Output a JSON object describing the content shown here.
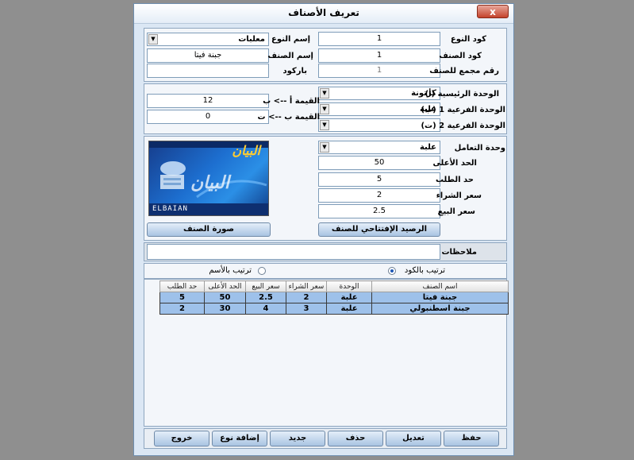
{
  "window": {
    "title": "تعريف الأصناف",
    "close_glyph": "x"
  },
  "basic": {
    "type_code_label": "كود النوع",
    "type_code_value": "1",
    "type_name_label": "إسم النوع",
    "type_name_value": "معلبات",
    "item_code_label": "كود الصنف",
    "item_code_value": "1",
    "item_name_label": "إسم الصنف",
    "item_name_value": "جبنة فيتا",
    "group_no_label": "رقم مجمع للصنف",
    "group_no_value": "1",
    "barcode_label": "باركود",
    "barcode_value": ""
  },
  "units": {
    "main_unit_label": "الوحدة الرئيسية (أ)",
    "main_unit_value": "كرتونة",
    "sub1_label": "الوحدة الفرعية 1 (ب)",
    "sub1_value": "علبة",
    "sub2_label": "الوحدة الفرعية 2 (ت)",
    "sub2_value": "",
    "value_ab_label": "القيمة أ --> ب",
    "value_ab": "12",
    "value_bt_label": "القيمة ب --> ت",
    "value_bt": "0"
  },
  "pricing": {
    "deal_unit_label": "وحدة التعامل",
    "deal_unit_value": "علبة",
    "max_label": "الحد الأعلى",
    "max_value": "50",
    "reorder_label": "حد الطلب",
    "reorder_value": "5",
    "buy_label": "سعر الشراء",
    "buy_value": "2",
    "sell_label": "سعر البيع",
    "sell_value": "2.5",
    "opening_balance_button": "الرصيد الإفتتاحي للصنف",
    "item_image_button": "صورة الصنف"
  },
  "logo": {
    "arabic": "البيان",
    "latin": "ELBAIAN"
  },
  "notes": {
    "label": "ملاحظات",
    "value": ""
  },
  "sort": {
    "by_code": "ترتيب بالكود",
    "by_name": "ترتيب بالأسم",
    "selected": "by_code"
  },
  "table": {
    "columns": [
      "اسم الصنف",
      "الوحدة",
      "سعر الشراء",
      "سعر البيع",
      "الحد الأعلى",
      "حد الطلب"
    ],
    "rows": [
      [
        "جبنة فيتا",
        "علبة",
        "2",
        "2.5",
        "50",
        "5"
      ],
      [
        "جبنة اسطنبولي",
        "علبة",
        "3",
        "4",
        "30",
        "2"
      ]
    ]
  },
  "actions": {
    "save": "حفظ",
    "edit": "تعديل",
    "delete": "حذف",
    "new": "جديد",
    "add_type": "إضافة نوع",
    "exit": "خروج"
  }
}
